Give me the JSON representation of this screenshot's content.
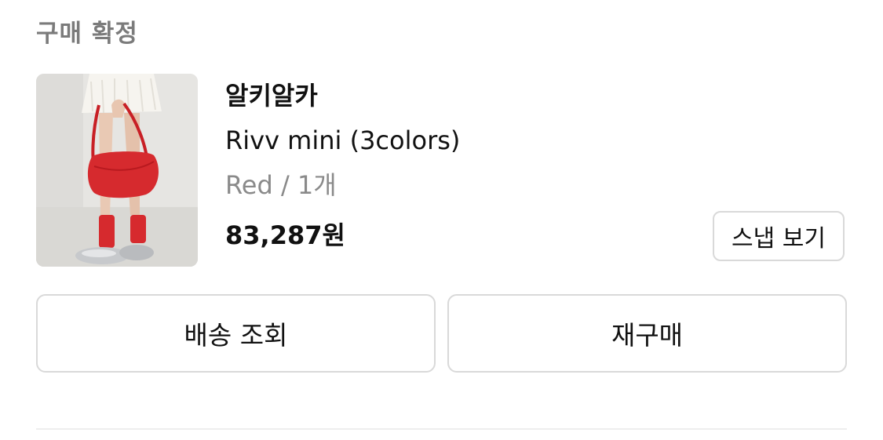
{
  "order": {
    "status_label": "구매 확정"
  },
  "product": {
    "image_alt": "product-photo",
    "brand": "알키알카",
    "name": "Rivv mini (3colors)",
    "option": "Red / 1개",
    "price": "83,287원"
  },
  "buttons": {
    "snap": "스냅 보기",
    "tracking": "배송 조회",
    "reorder": "재구매"
  },
  "colors": {
    "accent_product": "#d62a2e",
    "border": "#d9d9d9",
    "muted_text": "#8a8a8a"
  }
}
